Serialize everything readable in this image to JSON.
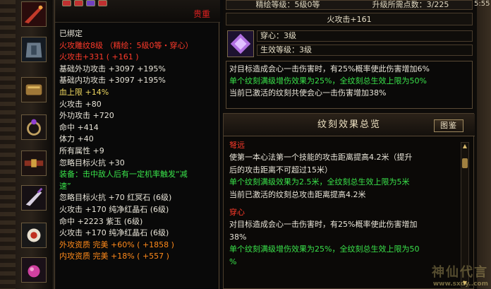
{
  "tooltip": {
    "rarity": "贵重",
    "lines": [
      {
        "text": "已绑定",
        "color": "#e8e4d8"
      },
      {
        "text": "火攻雕纹8级 （精绘：5级0等・穿心）",
        "color": "#ff3a2a"
      },
      {
        "text": "火攻击+331 ( +161 )",
        "color": "#ff3a2a"
      },
      {
        "text": "基础外功攻击 +3097 +195%",
        "color": "#e8e4d8"
      },
      {
        "text": "基础内功攻击 +3097 +195%",
        "color": "#e8e4d8"
      },
      {
        "text": "血上限 +14%",
        "color": "#f0d860"
      },
      {
        "text": "火攻击 +80",
        "color": "#e8e4d8"
      },
      {
        "text": "外功攻击 +720",
        "color": "#e8e4d8"
      },
      {
        "text": "命中 +414",
        "color": "#e8e4d8"
      },
      {
        "text": "体力 +40",
        "color": "#e8e4d8"
      },
      {
        "text": "所有属性 +9",
        "color": "#e8e4d8"
      },
      {
        "text": "忽略目标火抗 +30",
        "color": "#e8e4d8"
      },
      {
        "text": "装备：击中敌人后有一定机率触发“减",
        "color": "#39e24a"
      },
      {
        "text": "速”",
        "color": "#39e24a"
      },
      {
        "text": "忽略目标火抗 +70 红冥石 (6级)",
        "color": "#e8e4d8"
      },
      {
        "text": "火攻击 +170 纯净红晶石 (6级)",
        "color": "#e8e4d8"
      },
      {
        "text": "命中 +2223 紫玉 (6级)",
        "color": "#e8e4d8"
      },
      {
        "text": "火攻击 +170 纯净红晶石 (6级)",
        "color": "#e8e4d8"
      },
      {
        "text": "外攻资质  完美 +60% ( +1858 )",
        "color": "#ff8a1a"
      },
      {
        "text": "内攻资质  完美 +18% ( +557 )",
        "color": "#ff8a1a"
      }
    ]
  },
  "right": {
    "fine_level": "精绘等级：5级0等",
    "upgrade_points": "升级所需点数：3/225",
    "title": "火攻击+161",
    "pierce_label": "穿心：3级",
    "effect_level": "生效等级：3级",
    "desc_lines": [
      {
        "text": "对目标造成会心一击伤害时，有25%概率使此伤害增加6%",
        "color": "#e8e4d8"
      },
      {
        "text": "单个纹刻满级增伤效果为25%，全纹刻总生效上限为50%",
        "color": "#39e24a"
      },
      {
        "text": "当前已激活的纹刻共使会心一击伤害增加38%",
        "color": "#e8e4d8"
      }
    ]
  },
  "summary": {
    "header": "纹刻效果总览",
    "button": "图鉴",
    "sections": [
      {
        "lines": [
          {
            "text": "弩远",
            "color": "#ff3a2a"
          },
          {
            "text": "使第一本心法第一个技能的攻击距离提高4.2米（提升",
            "color": "#e8e4d8"
          },
          {
            "text": "后的攻击距离不可超过15米）",
            "color": "#e8e4d8"
          },
          {
            "text": "单个纹刻满级效果为2.5米，全纹刻总生效上限为5米",
            "color": "#39e24a"
          },
          {
            "text": "当前已激活的纹刻总攻击距离提高4.2米",
            "color": "#e8e4d8"
          }
        ]
      },
      {
        "lines": [
          {
            "text": "穿心",
            "color": "#ff3a2a"
          },
          {
            "text": "对目标造成会心一击伤害时，有25%概率使此伤害增加",
            "color": "#e8e4d8"
          },
          {
            "text": "38%",
            "color": "#e8e4d8"
          },
          {
            "text": "单个纹刻满级增伤效果为25%，全纹刻总生效上限为50",
            "color": "#39e24a"
          },
          {
            "text": "%",
            "color": "#39e24a"
          }
        ]
      }
    ]
  },
  "clock": "5:55",
  "watermark": {
    "logo": "神仙代言",
    "url": "www.sxdy..com"
  }
}
